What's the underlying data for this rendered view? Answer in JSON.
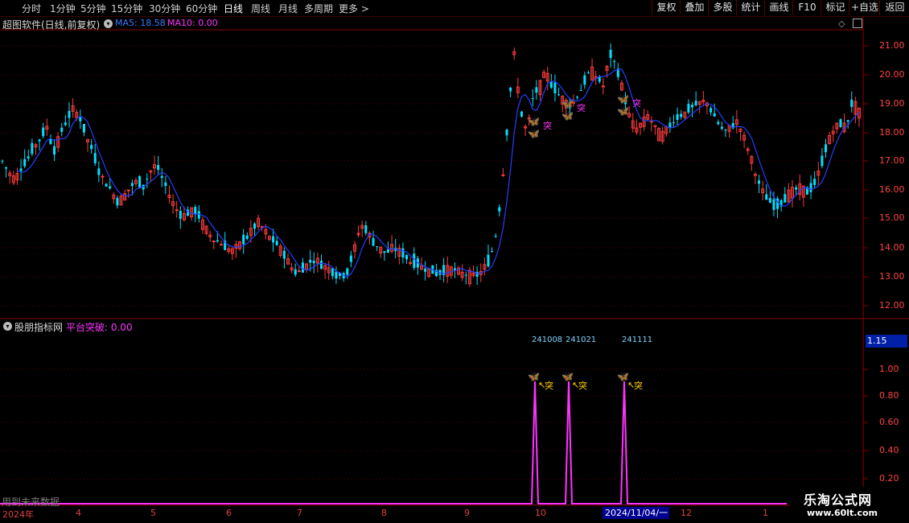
{
  "toolbar": {
    "tabs": [
      "分时",
      "1分钟",
      "5分钟",
      "15分钟",
      "30分钟",
      "60分钟",
      "日线",
      "周线",
      "月线",
      "多周期",
      "更多 >"
    ],
    "active_tab": "日线",
    "right_buttons": [
      "复权",
      "叠加",
      "多股",
      "统计",
      "画线",
      "F10",
      "标记",
      "+自选",
      "返回"
    ]
  },
  "main_panel": {
    "title": "超图软件(日线,前复权)",
    "ma5_label": "MA5: 18.58",
    "ma10_label": "MA10: 0.00",
    "y_ticks": [
      "21.00",
      "20.00",
      "19.00",
      "18.00",
      "17.00",
      "16.00",
      "15.00",
      "14.00",
      "13.00",
      "12.00"
    ],
    "marker_text": "突"
  },
  "sub_panel": {
    "title": "股朋指标网",
    "value_label": "平台突破: 0.00",
    "y_ticks": [
      "1.00",
      "0.80",
      "0.60",
      "0.40",
      "0.20"
    ],
    "cursor_value": "1.15",
    "date_labels": [
      "241008",
      "241021",
      "241111"
    ],
    "marker_text": "突"
  },
  "x_axis": {
    "labels": [
      "2024年",
      "4",
      "5",
      "6",
      "7",
      "8",
      "9",
      "10",
      "12",
      "1"
    ],
    "highlight": "2024/11/04/一"
  },
  "footer_note": "用到未来数据",
  "watermark": {
    "line1": "乐淘公式网",
    "line2": "www.60lt.com"
  },
  "colors": {
    "up": "#ff3b3b",
    "down": "#00e0ff",
    "ma5": "#2040ff",
    "signal": "#ff33ff",
    "axis": "#8b0000",
    "grid": "#5a0000"
  },
  "chart_data": {
    "type": "candlestick",
    "ylim": [
      11.8,
      21.4
    ],
    "sub_ylim": [
      0,
      1.15
    ],
    "close_path": [
      17.0,
      16.6,
      16.4,
      16.8,
      17.1,
      17.5,
      17.8,
      18.2,
      17.3,
      17.9,
      18.4,
      18.8,
      18.6,
      17.9,
      17.4,
      16.7,
      16.3,
      16.0,
      15.6,
      15.8,
      16.1,
      16.3,
      16.1,
      16.6,
      16.9,
      16.4,
      15.9,
      15.4,
      15.1,
      15.2,
      15.3,
      15.0,
      14.6,
      14.3,
      14.2,
      14.0,
      13.9,
      14.1,
      14.3,
      14.6,
      14.9,
      14.6,
      14.3,
      14.1,
      13.8,
      13.4,
      13.1,
      13.3,
      13.5,
      13.6,
      13.4,
      13.3,
      13.1,
      13.0,
      13.2,
      13.9,
      14.8,
      14.6,
      14.2,
      14.0,
      13.8,
      14.0,
      13.9,
      13.7,
      13.5,
      13.4,
      13.3,
      13.2,
      13.1,
      13.2,
      13.3,
      13.2,
      13.1,
      13.1,
      13.0,
      13.2,
      13.5,
      14.2,
      15.8,
      18.3,
      20.8,
      18.8,
      18.0,
      19.2,
      19.6,
      20.1,
      19.6,
      19.3,
      19.1,
      18.9,
      19.3,
      19.7,
      20.2,
      19.9,
      19.6,
      20.7,
      20.3,
      19.5,
      18.6,
      18.1,
      18.3,
      18.6,
      18.2,
      17.9,
      18.1,
      18.4,
      18.6,
      18.7,
      18.9,
      19.0,
      19.1,
      18.7,
      18.3,
      18.0,
      18.2,
      18.4,
      17.8,
      17.2,
      16.4,
      15.9,
      15.6,
      15.4,
      15.6,
      15.9,
      16.0,
      16.1,
      15.9,
      16.2,
      16.8,
      17.6,
      18.1,
      18.3,
      18.2,
      19.1,
      18.7
    ],
    "signal_dates": [
      "241008",
      "241021",
      "241111"
    ],
    "signal_value": 1.0
  }
}
